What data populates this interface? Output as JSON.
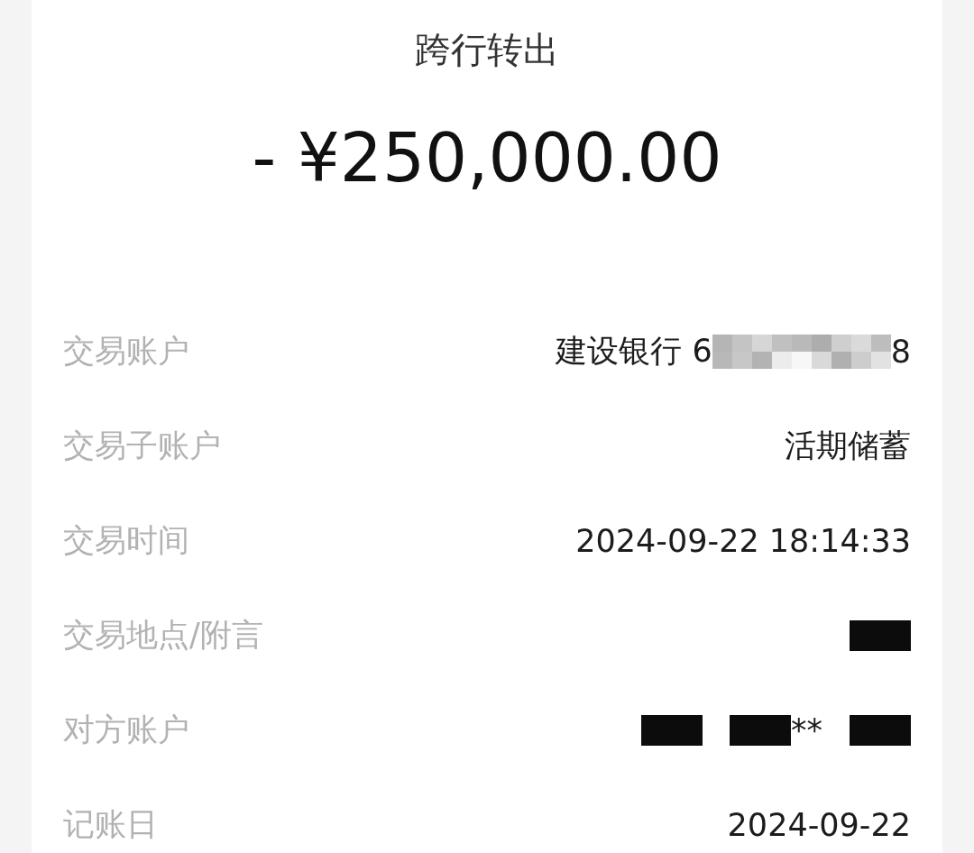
{
  "title": "跨行转出",
  "amount": "- ¥250,000.00",
  "rows": [
    {
      "label": "交易账户",
      "value": [
        {
          "kind": "text",
          "text": "建设银行 6"
        },
        {
          "kind": "mosaic"
        },
        {
          "kind": "text",
          "text": "8"
        }
      ]
    },
    {
      "label": "交易子账户",
      "value": [
        {
          "kind": "text",
          "text": "活期储蓄"
        }
      ]
    },
    {
      "label": "交易时间",
      "value": [
        {
          "kind": "text",
          "text": "2024-09-22 18:14:33"
        }
      ]
    },
    {
      "label": "交易地点/附言",
      "value": [
        {
          "kind": "redacted"
        }
      ]
    },
    {
      "label": "对方账户",
      "value": [
        {
          "kind": "redacted"
        },
        {
          "kind": "redacted"
        },
        {
          "kind": "text",
          "text": "**"
        },
        {
          "kind": "redacted"
        }
      ]
    },
    {
      "label": "记账日",
      "value": [
        {
          "kind": "text",
          "text": "2024-09-22"
        }
      ]
    }
  ]
}
